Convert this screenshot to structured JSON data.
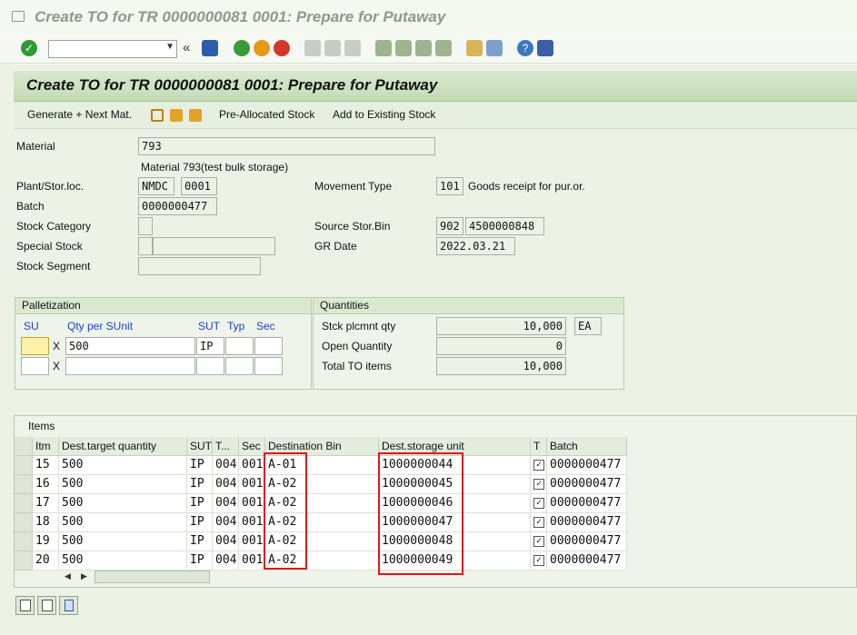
{
  "window": {
    "title": "Create TO for TR 0000000081 0001: Prepare for Putaway"
  },
  "header": {
    "title": "Create TO for TR 0000000081 0001: Prepare for Putaway"
  },
  "app_toolbar": {
    "generate_next": "Generate + Next Mat.",
    "pre_allocated": "Pre-Allocated Stock",
    "add_existing": "Add to Existing Stock"
  },
  "form": {
    "material_label": "Material",
    "material_value": "793",
    "material_desc": "Material 793(test bulk storage)",
    "plant_label": "Plant/Stor.loc.",
    "plant_value": "NMDC",
    "sloc_value": "0001",
    "batch_label": "Batch",
    "batch_value": "0000000477",
    "stock_category_label": "Stock Category",
    "special_stock_label": "Special Stock",
    "stock_segment_label": "Stock Segment",
    "movement_type_label": "Movement Type",
    "movement_type_value": "101",
    "movement_type_desc": "Goods receipt for pur.or.",
    "source_bin_label": "Source Stor.Bin",
    "source_type_value": "902",
    "source_bin_value": "4500000848",
    "gr_date_label": "GR Date",
    "gr_date_value": "2022.03.21"
  },
  "palletization": {
    "title": "Palletization",
    "col_su": "SU",
    "col_qty": "Qty per SUnit",
    "col_sut": "SUT",
    "col_typ": "Typ",
    "col_sec": "Sec",
    "row1_x": "X",
    "row1_qty": "500",
    "row1_sut": "IP",
    "row2_x": "X"
  },
  "quantities": {
    "title": "Quantities",
    "stck_label": "Stck plcmnt qty",
    "stck_value": "10,000",
    "stck_unit": "EA",
    "open_label": "Open Quantity",
    "open_value": "0",
    "total_label": "Total TO items",
    "total_value": "10,000"
  },
  "items": {
    "title": "Items",
    "columns": [
      "Itm",
      "Dest.target quantity",
      "SUT",
      "T...",
      "Sec",
      "Destination Bin",
      "Dest.storage unit",
      "T",
      "Batch"
    ],
    "rows": [
      {
        "itm": "15",
        "qty": "500",
        "sut": "IP",
        "t": "004",
        "sec": "001",
        "bin": "A-01",
        "su": "1000000044",
        "checked": true,
        "batch": "0000000477"
      },
      {
        "itm": "16",
        "qty": "500",
        "sut": "IP",
        "t": "004",
        "sec": "001",
        "bin": "A-02",
        "su": "1000000045",
        "checked": true,
        "batch": "0000000477"
      },
      {
        "itm": "17",
        "qty": "500",
        "sut": "IP",
        "t": "004",
        "sec": "001",
        "bin": "A-02",
        "su": "1000000046",
        "checked": true,
        "batch": "0000000477"
      },
      {
        "itm": "18",
        "qty": "500",
        "sut": "IP",
        "t": "004",
        "sec": "001",
        "bin": "A-02",
        "su": "1000000047",
        "checked": true,
        "batch": "0000000477"
      },
      {
        "itm": "19",
        "qty": "500",
        "sut": "IP",
        "t": "004",
        "sec": "001",
        "bin": "A-02",
        "su": "1000000048",
        "checked": true,
        "batch": "0000000477"
      },
      {
        "itm": "20",
        "qty": "500",
        "sut": "IP",
        "t": "004",
        "sec": "001",
        "bin": "A-02",
        "su": "1000000049",
        "checked": true,
        "batch": "0000000477"
      }
    ]
  },
  "colors": {
    "accent": "#c3dbb6",
    "highlight": "#e0151b",
    "field_focus": "#fff2a8"
  }
}
